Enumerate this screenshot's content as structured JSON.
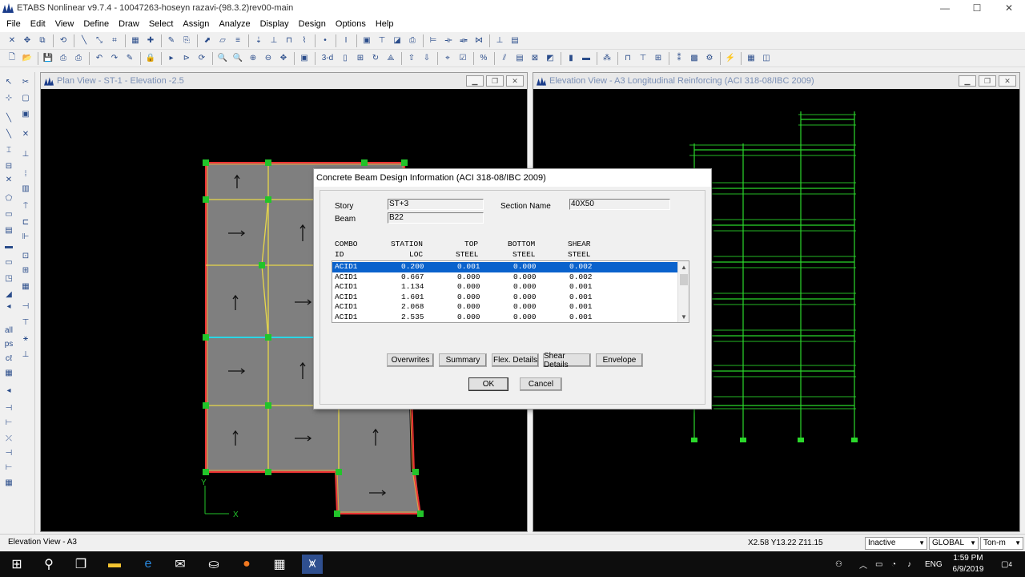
{
  "window": {
    "title": "ETABS Nonlinear v9.7.4 - 10047263-hoseyn razavi-(98.3.2)rev00-main",
    "min": "—",
    "max": "☐",
    "close": "✕"
  },
  "menu": [
    "File",
    "Edit",
    "View",
    "Define",
    "Draw",
    "Select",
    "Assign",
    "Analyze",
    "Display",
    "Design",
    "Options",
    "Help"
  ],
  "plan_view": {
    "title": "Plan View - ST-1 - Elevation -2.5",
    "axis_y": "Y",
    "axis_x": "X"
  },
  "elevation_view": {
    "title": "Elevation View - A3  Longitudinal Reinforcing  (ACI 318-08/IBC 2009)"
  },
  "dialog": {
    "title": "Concrete Beam Design Information (ACI 318-08/IBC 2009)",
    "story_label": "Story",
    "story_value": "ST+3",
    "beam_label": "Beam",
    "beam_value": "B22",
    "section_label": "Section Name",
    "section_value": "40X50",
    "headers": {
      "combo1": "COMBO",
      "combo2": "ID",
      "station1": "STATION",
      "station2": "LOC",
      "top1": "TOP",
      "top2": "STEEL",
      "bottom1": "BOTTOM",
      "bottom2": "STEEL",
      "shear1": "SHEAR",
      "shear2": "STEEL"
    },
    "rows": [
      {
        "combo": "ACID1",
        "loc": "0.200",
        "top": "0.001",
        "bottom": "0.000",
        "shear": "0.002"
      },
      {
        "combo": "ACID1",
        "loc": "0.667",
        "top": "0.000",
        "bottom": "0.000",
        "shear": "0.002"
      },
      {
        "combo": "ACID1",
        "loc": "1.134",
        "top": "0.000",
        "bottom": "0.000",
        "shear": "0.001"
      },
      {
        "combo": "ACID1",
        "loc": "1.601",
        "top": "0.000",
        "bottom": "0.000",
        "shear": "0.001"
      },
      {
        "combo": "ACID1",
        "loc": "2.068",
        "top": "0.000",
        "bottom": "0.000",
        "shear": "0.001"
      },
      {
        "combo": "ACID1",
        "loc": "2.535",
        "top": "0.000",
        "bottom": "0.000",
        "shear": "0.001"
      }
    ],
    "buttons": {
      "overwrites": "Overwrites",
      "summary": "Summary",
      "flex": "Flex. Details",
      "shear": "Shear Details",
      "envelope": "Envelope",
      "ok": "OK",
      "cancel": "Cancel"
    }
  },
  "status": {
    "text": "Elevation View - A3",
    "coords": "X2.58  Y13.22  Z11.15",
    "mode": "Inactive",
    "system": "GLOBAL",
    "units": "Ton-m"
  },
  "taskbar": {
    "lang": "ENG",
    "time": "1:59 PM",
    "date": "6/9/2019",
    "notif": "4"
  },
  "colors": {
    "selection": "#0a62cc",
    "frame": "#e8d84a",
    "joint": "#22c42a",
    "slab": "#7f7f7f",
    "beam_highlight": "#2ad6e6",
    "elevation_text": "#2bd82b"
  }
}
